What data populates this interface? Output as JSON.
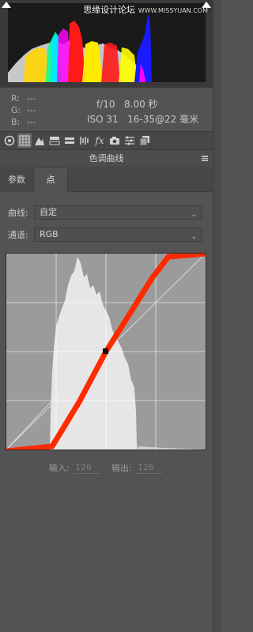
{
  "watermark": {
    "text": "思缘设计论坛",
    "site": "WWW.MISSYUAN.COM"
  },
  "histogram": {
    "shadow_clip_icon": "triangle-up-icon",
    "highlight_clip_icon": "triangle-up-icon"
  },
  "readout": {
    "r_label": "R:",
    "r_value": "---",
    "g_label": "G:",
    "g_value": "---",
    "b_label": "B:",
    "b_value": "---",
    "aperture": "f/10",
    "shutter": "8.00 秒",
    "iso": "ISO 31",
    "lens": "16-35@22 毫米"
  },
  "toolbar": {
    "icons": [
      "aperture-icon",
      "curve-grid-icon",
      "mountain-icon",
      "split-icon",
      "hsl-icon",
      "detail-icon",
      "fx-icon",
      "camera-icon",
      "sliders-icon",
      "presets-icon"
    ]
  },
  "section": {
    "title": "色调曲线"
  },
  "tabs": {
    "params": "参数",
    "point": "点"
  },
  "curve_select": {
    "label": "曲线:",
    "value": "自定"
  },
  "channel_select": {
    "label": "通道:",
    "value": "RGB"
  },
  "io": {
    "input_label": "输入:",
    "input_value": "126",
    "output_label": "输出:",
    "output_value": "126"
  },
  "colors": {
    "curve": "#ff2a00",
    "panel": "#535353",
    "histogram_bg": "#3a3a3a"
  }
}
